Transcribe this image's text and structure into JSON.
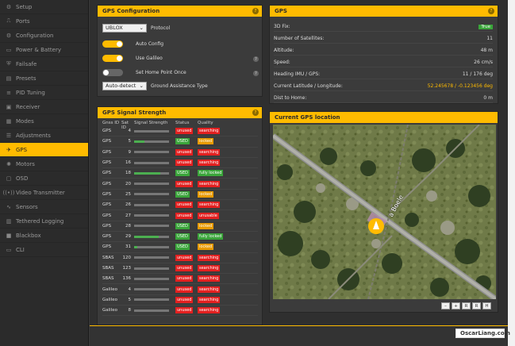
{
  "sidebar": {
    "items": [
      {
        "label": "Setup",
        "icon": "wrench-icon",
        "glyph": "⚙"
      },
      {
        "label": "Ports",
        "icon": "plug-icon",
        "glyph": "⎍"
      },
      {
        "label": "Configuration",
        "icon": "gear-icon",
        "glyph": "⚙"
      },
      {
        "label": "Power & Battery",
        "icon": "battery-icon",
        "glyph": "▭"
      },
      {
        "label": "Failsafe",
        "icon": "shield-icon",
        "glyph": "⛨"
      },
      {
        "label": "Presets",
        "icon": "presets-icon",
        "glyph": "▤"
      },
      {
        "label": "PID Tuning",
        "icon": "sliders-icon",
        "glyph": "≡"
      },
      {
        "label": "Receiver",
        "icon": "receiver-icon",
        "glyph": "▣"
      },
      {
        "label": "Modes",
        "icon": "modes-icon",
        "glyph": "▦"
      },
      {
        "label": "Adjustments",
        "icon": "adjustments-icon",
        "glyph": "☰"
      },
      {
        "label": "GPS",
        "icon": "satellite-icon",
        "glyph": "✈",
        "active": true
      },
      {
        "label": "Motors",
        "icon": "motor-icon",
        "glyph": "✺"
      },
      {
        "label": "OSD",
        "icon": "osd-icon",
        "glyph": "▢"
      },
      {
        "label": "Video Transmitter",
        "icon": "vtx-icon",
        "glyph": "((•))"
      },
      {
        "label": "Sensors",
        "icon": "sensors-icon",
        "glyph": "∿"
      },
      {
        "label": "Tethered Logging",
        "icon": "logging-icon",
        "glyph": "▥"
      },
      {
        "label": "Blackbox",
        "icon": "blackbox-icon",
        "glyph": "■"
      },
      {
        "label": "CLI",
        "icon": "terminal-icon",
        "glyph": "▭"
      }
    ]
  },
  "config": {
    "title": "GPS Configuration",
    "protocol_value": "UBLOX",
    "protocol_label": "Protocol",
    "auto_config_label": "Auto Config",
    "auto_config_on": true,
    "use_galileo_label": "Use Galileo",
    "use_galileo_on": true,
    "home_point_label": "Set Home Point Once",
    "home_point_on": false,
    "assist_value": "Auto-detect",
    "assist_label": "Ground Assistance Type"
  },
  "signal": {
    "title": "GPS Signal Strength",
    "headers": [
      "Gnss ID",
      "Sat ID",
      "Signal Strength",
      "Status",
      "Quality"
    ],
    "rows": [
      {
        "sys": "GPS",
        "id": "4",
        "strength": 0,
        "status": "unused",
        "quality": "searching"
      },
      {
        "sys": "GPS",
        "id": "5",
        "strength": 0.3,
        "status": "USED",
        "quality": "locked"
      },
      {
        "sys": "GPS",
        "id": "9",
        "strength": 0,
        "status": "unused",
        "quality": "searching"
      },
      {
        "sys": "GPS",
        "id": "16",
        "strength": 0,
        "status": "unused",
        "quality": "searching"
      },
      {
        "sys": "GPS",
        "id": "18",
        "strength": 0.75,
        "status": "USED",
        "quality": "fully locked"
      },
      {
        "sys": "GPS",
        "id": "20",
        "strength": 0,
        "status": "unused",
        "quality": "searching"
      },
      {
        "sys": "GPS",
        "id": "25",
        "strength": 0,
        "status": "USED",
        "quality": "locked"
      },
      {
        "sys": "GPS",
        "id": "26",
        "strength": 0,
        "status": "unused",
        "quality": "searching"
      },
      {
        "sys": "GPS",
        "id": "27",
        "strength": 0,
        "status": "unused",
        "quality": "unusable"
      },
      {
        "sys": "GPS",
        "id": "28",
        "strength": 0,
        "status": "USED",
        "quality": "locked"
      },
      {
        "sys": "GPS",
        "id": "29",
        "strength": 0.7,
        "status": "USED",
        "quality": "fully locked"
      },
      {
        "sys": "GPS",
        "id": "31",
        "strength": 0.1,
        "status": "USED",
        "quality": "locked"
      },
      {
        "sys": "SBAS",
        "id": "120",
        "strength": 0,
        "status": "unused",
        "quality": "searching"
      },
      {
        "sys": "SBAS",
        "id": "123",
        "strength": 0,
        "status": "unused",
        "quality": "searching"
      },
      {
        "sys": "SBAS",
        "id": "136",
        "strength": 0,
        "status": "unused",
        "quality": "searching"
      },
      {
        "sys": "Galileo",
        "id": "4",
        "strength": 0,
        "status": "unused",
        "quality": "searching"
      },
      {
        "sys": "Galileo",
        "id": "5",
        "strength": 0,
        "status": "unused",
        "quality": "searching"
      },
      {
        "sys": "Galileo",
        "id": "8",
        "strength": 0,
        "status": "unused",
        "quality": "searching"
      }
    ]
  },
  "info": {
    "title": "GPS",
    "rows": [
      {
        "label": "3D Fix:",
        "value": "True",
        "kind": "badge"
      },
      {
        "label": "Number of Satellites:",
        "value": "11"
      },
      {
        "label": "Altitude:",
        "value": "48 m"
      },
      {
        "label": "Speed:",
        "value": "26 cm/s"
      },
      {
        "label": "Heading IMU / GPS:",
        "value": "11 / 176 deg"
      },
      {
        "label": "Current Latitude / Longitude:",
        "value": "52.245678 / -0.123456 deg",
        "kind": "yellow"
      },
      {
        "label": "Dist to Home:",
        "value": "0 m"
      }
    ]
  },
  "map": {
    "title": "Current GPS location",
    "road_label": "a Boele",
    "buttons": [
      "–",
      "+",
      "R",
      "R",
      "H"
    ]
  },
  "watermark": "OscarLiang.com",
  "colors": {
    "accent": "#ffbb00",
    "used": "#3aa53a",
    "unused": "#e32020",
    "locked": "#e89a00"
  }
}
